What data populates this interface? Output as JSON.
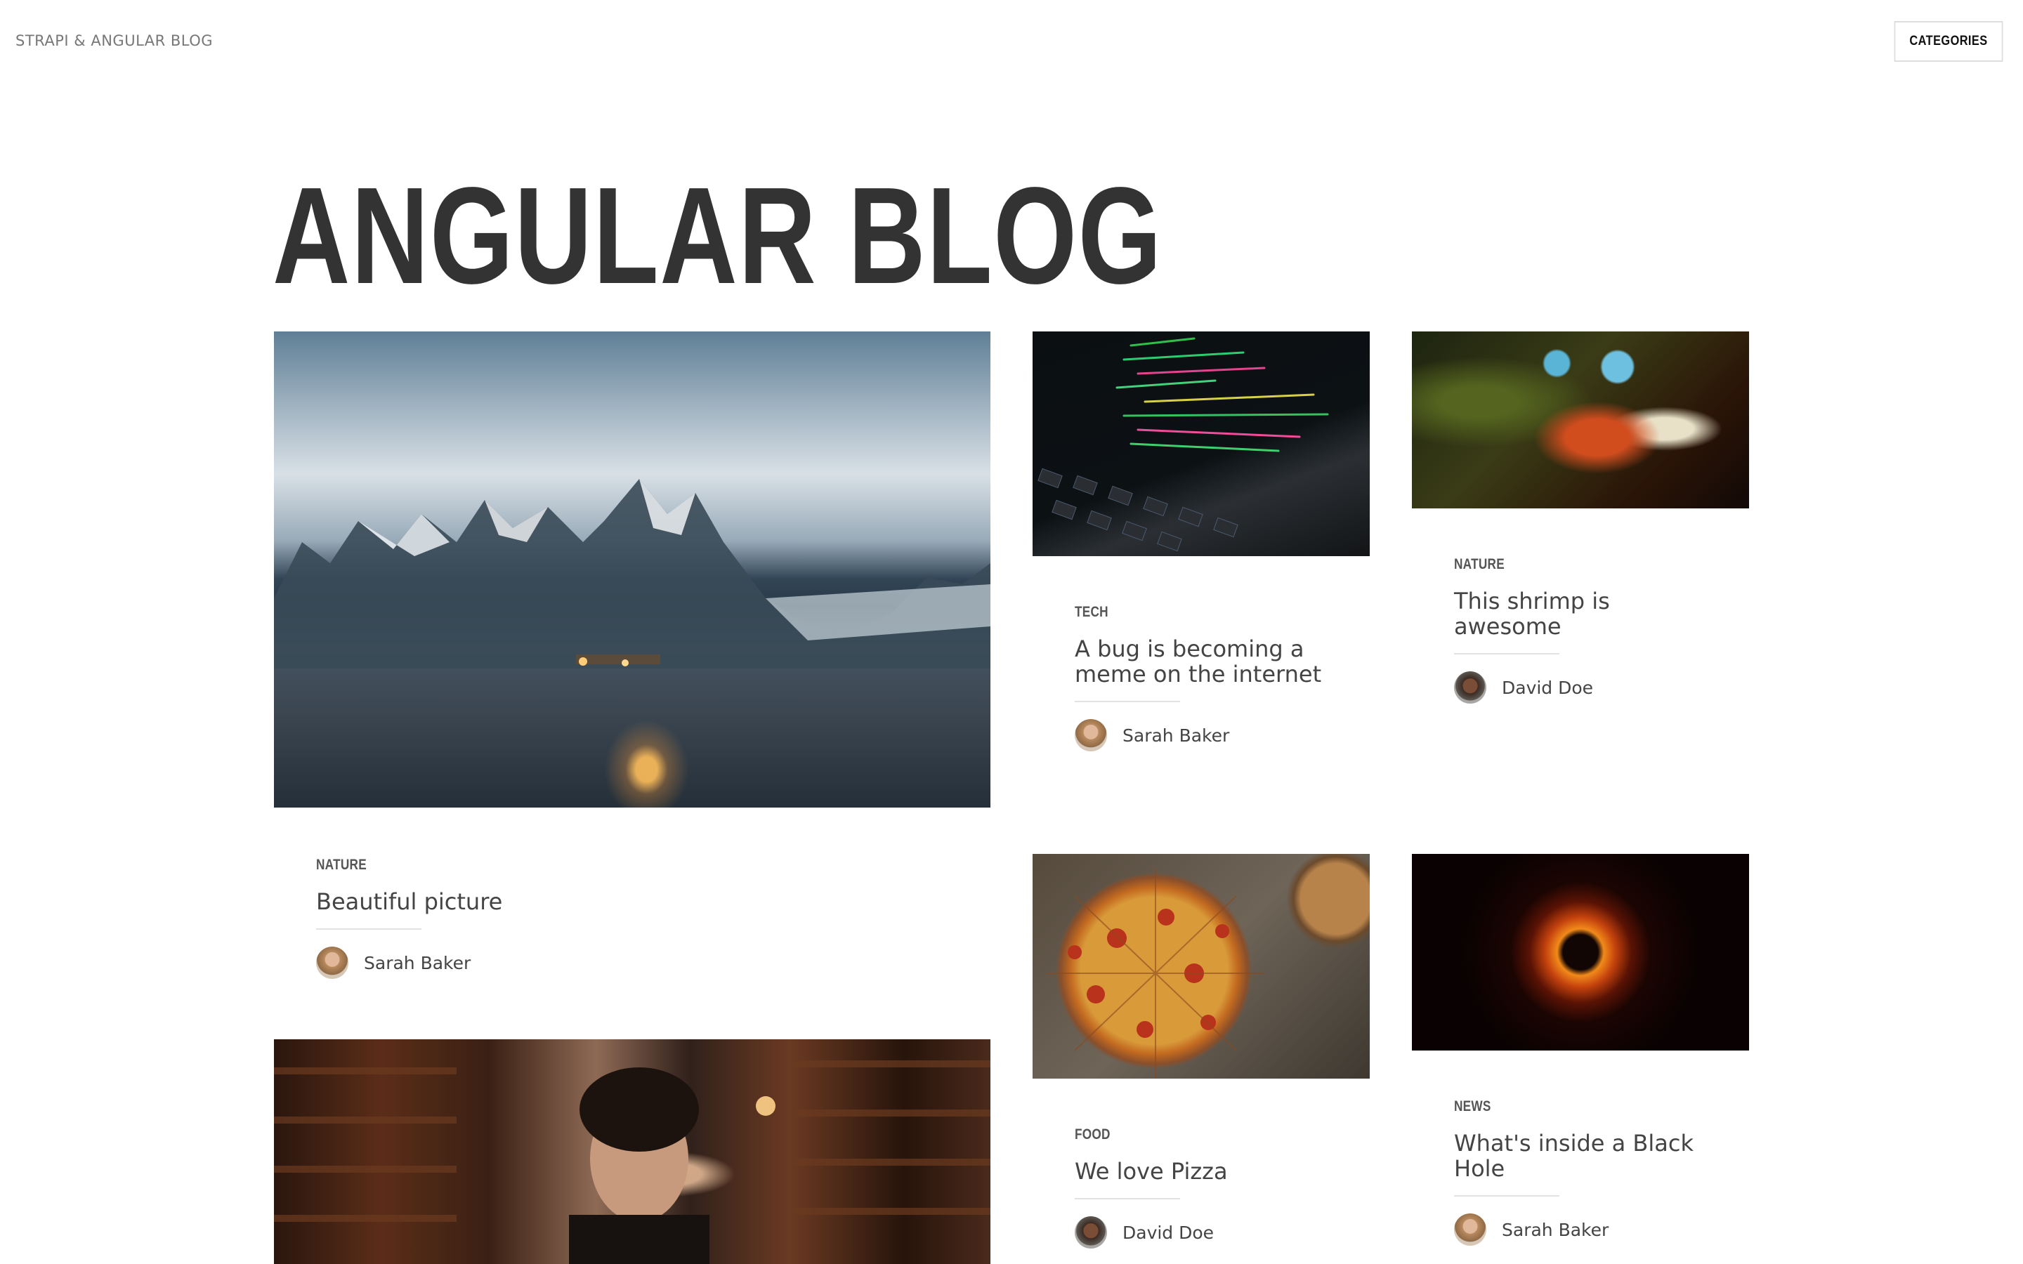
{
  "nav": {
    "brand": "STRAPI & ANGULAR BLOG",
    "categories_button": "CATEGORIES"
  },
  "hero": {
    "title": "ANGULAR BLOG"
  },
  "articles": [
    {
      "category": "NATURE",
      "title": "Beautiful picture",
      "author": "Sarah Baker",
      "image": "mountain-camp-photo"
    },
    {
      "category": "TECH",
      "title": "A bug is becoming a meme on the internet",
      "author": "Sarah Baker",
      "image": "laptop-code-photo"
    },
    {
      "category": "NATURE",
      "title": "This shrimp is awesome",
      "author": "David Doe",
      "image": "mantis-shrimp-photo"
    },
    {
      "category": "FOOD",
      "title": "We love Pizza",
      "author": "David Doe",
      "image": "pizza-photo"
    },
    {
      "category": "NEWS",
      "title": "What's inside a Black Hole",
      "author": "Sarah Baker",
      "image": "black-hole-photo"
    },
    {
      "category": "",
      "title": "",
      "author": "",
      "image": "library-portrait-photo"
    }
  ]
}
